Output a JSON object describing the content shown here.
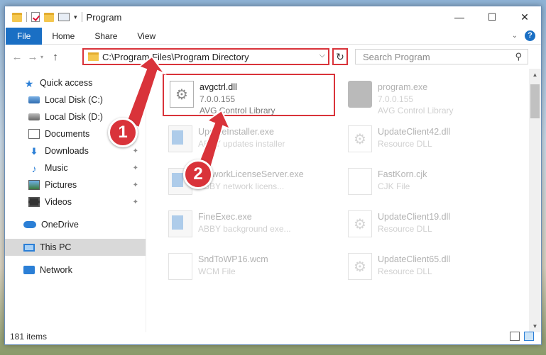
{
  "window": {
    "title": "Program",
    "controls": {
      "minimize": "—",
      "maximize": "☐",
      "close": "✕"
    }
  },
  "ribbon": {
    "tabs": [
      "File",
      "Home",
      "Share",
      "View"
    ],
    "help": "?"
  },
  "address": {
    "path": "C:\\Program Files\\Program Directory",
    "search_placeholder": "Search Program"
  },
  "sidebar": {
    "items": [
      {
        "label": "Quick access",
        "icon": "star-icon"
      },
      {
        "label": "Local Disk (C:)",
        "icon": "disk-icon"
      },
      {
        "label": "Local Disk (D:)",
        "icon": "disk-icon"
      },
      {
        "label": "Documents",
        "icon": "documents-icon"
      },
      {
        "label": "Downloads",
        "icon": "downloads-icon"
      },
      {
        "label": "Music",
        "icon": "music-icon"
      },
      {
        "label": "Pictures",
        "icon": "pictures-icon"
      },
      {
        "label": "Videos",
        "icon": "videos-icon"
      },
      {
        "label": "OneDrive",
        "icon": "cloud-icon"
      },
      {
        "label": "This PC",
        "icon": "computer-icon"
      },
      {
        "label": "Network",
        "icon": "network-icon"
      }
    ]
  },
  "files": [
    {
      "name": "avgctrl.dll",
      "line2": "7.0.0.155",
      "line3": "AVG Control Library"
    },
    {
      "name": "program.exe",
      "line2": "7.0.0.155",
      "line3": "AVG Control Library"
    },
    {
      "name": "UpdateInstaller.exe",
      "line2": "ABBY updates installer",
      "line3": ""
    },
    {
      "name": "UpdateClient42.dll",
      "line2": "Resource DLL",
      "line3": ""
    },
    {
      "name": "NetworkLicenseServer.exe",
      "line2": "ABBY network licens...",
      "line3": ""
    },
    {
      "name": "FastKorn.cjk",
      "line2": "CJK File",
      "line3": ""
    },
    {
      "name": "FineExec.exe",
      "line2": "ABBY background exe...",
      "line3": ""
    },
    {
      "name": "UpdateClient19.dll",
      "line2": "Resource DLL",
      "line3": ""
    },
    {
      "name": "SndToWP16.wcm",
      "line2": "WCM File",
      "line3": ""
    },
    {
      "name": "UpdateClient65.dll",
      "line2": "Resource DLL",
      "line3": ""
    }
  ],
  "status": {
    "count": "181 items"
  },
  "annotations": {
    "step1": "1",
    "step2": "2"
  },
  "colors": {
    "accent": "#1a6fc4",
    "highlight": "#d9333a"
  }
}
